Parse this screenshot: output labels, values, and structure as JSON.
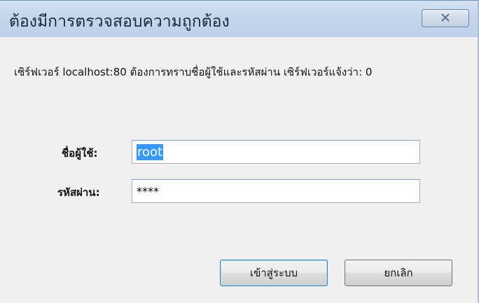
{
  "dialog": {
    "title": "ต้องมีการตรวจสอบความถูกต้อง",
    "message": "เซิร์ฟเวอร์ localhost:80 ต้องการทราบชื่อผู้ใช้และรหัสผ่าน เซิร์ฟเวอร์แจ้งว่า: 0"
  },
  "form": {
    "username_label": "ชื่อผู้ใช้:",
    "username_value": "root",
    "password_label": "รหัสผ่าน:",
    "password_value": "****"
  },
  "buttons": {
    "login_label": "เข้าสู่ระบบ",
    "cancel_label": "ยกเลิก"
  },
  "icons": {
    "close": "close-icon"
  },
  "colors": {
    "selection": "#3399ff",
    "titlebar": "#c6d7ec",
    "default_button_border": "#3c7fb1"
  }
}
